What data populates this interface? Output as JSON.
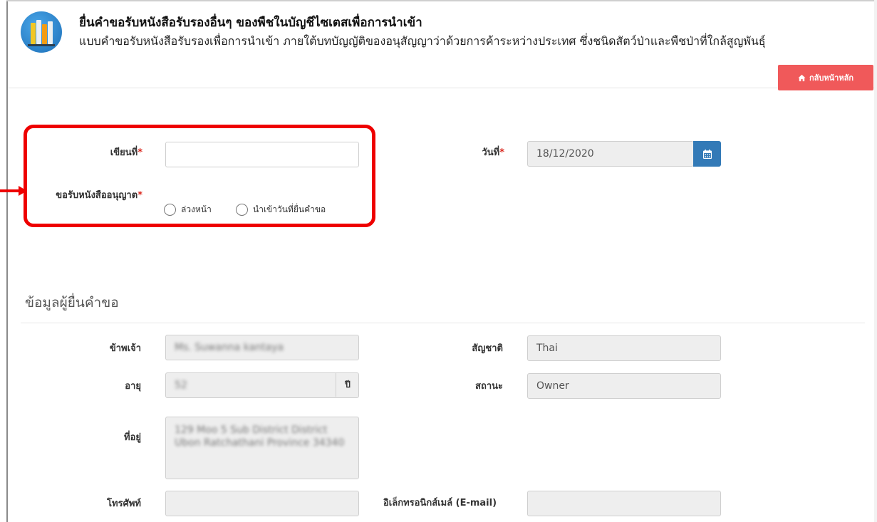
{
  "header": {
    "title": "ยื่นคำขอรับหนังสือรับรองอื่นๆ ของพืชในบัญชีไซเตสเพื่อการนำเข้า",
    "subtitle": "แบบคำขอรับหนังสือรับรองเพื่อการนำเข้า ภายใต้บทบัญญัติของอนุสัญญาว่าด้วยการค้าระหว่างประเทศ ซึ่งชนิดสัตว์ป่าและพืชป่าที่ใกล้สูญพันธุ์",
    "home_button_label": "กลับหน้าหลัก",
    "logo_icon": "books-icon"
  },
  "form": {
    "written_at_label": "เขียนที่",
    "written_at_value": "",
    "date_label": "วันที่",
    "date_value": "18/12/2020",
    "calendar_icon": "calendar-icon",
    "request_permit_label": "ขอรับหนังสืออนุญาต",
    "options": [
      "ล่วงหน้า",
      "นำเข้าวันที่ยื่นคำขอ"
    ],
    "required_marker": "*"
  },
  "applicant": {
    "section_title": "ข้อมูลผู้ยื่นคำขอ",
    "name_label": "ข้าพเจ้า",
    "name_value": "Ms. Suwanna kantaya",
    "nationality_label": "สัญชาติ",
    "nationality_value": "Thai",
    "age_label": "อายุ",
    "age_value": "52",
    "age_unit": "ปี",
    "status_label": "สถานะ",
    "status_value": "Owner",
    "address_label": "ที่อยู่",
    "address_value": "129 Moo 5 Sub District District Ubon Ratchathani Province 34340",
    "phone_label": "โทรศัพท์",
    "phone_value": "",
    "email_label": "อิเล็กทรอนิกส์เมล์ (E-mail)",
    "email_value": ""
  },
  "colors": {
    "highlight_frame": "#ee0000",
    "home_button": "#f0595a",
    "calendar_button": "#337ab7",
    "required": "#d9261c"
  }
}
